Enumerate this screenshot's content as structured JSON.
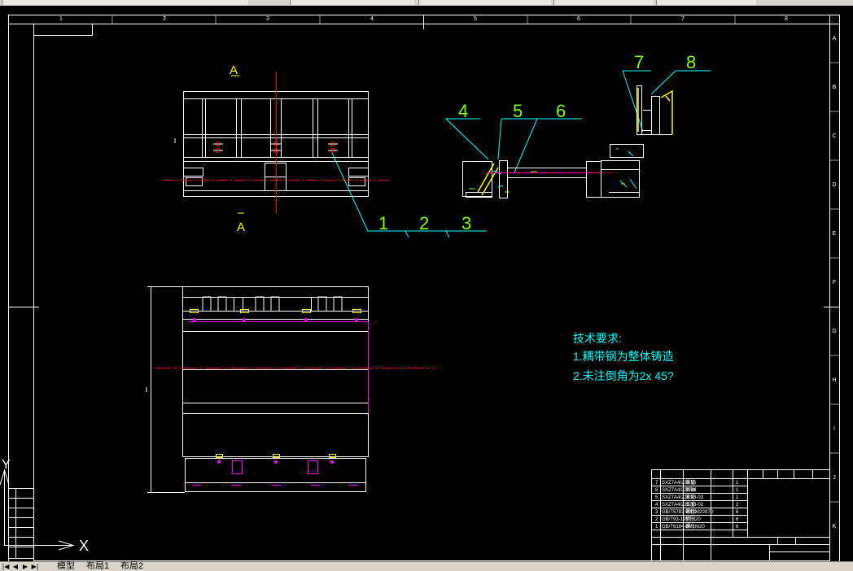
{
  "frame": {
    "column_labels": [
      "1",
      "2",
      "3",
      "4",
      "5",
      "6",
      "7",
      "8"
    ],
    "row_labels": [
      "A",
      "B",
      "C",
      "D",
      "E",
      "F",
      "G",
      "H",
      "I",
      "J",
      "K"
    ]
  },
  "section_marks": {
    "top": "A",
    "bottom": "A"
  },
  "balloons": [
    "1",
    "2",
    "3",
    "4",
    "5",
    "6",
    "7",
    "8"
  ],
  "tech_requirements": {
    "title": "技术要求:",
    "line1": "1.耦带钢为整体铸造",
    "line2": "2.未注倒角为2x 45?"
  },
  "bom_rows": [
    {
      "no": "7",
      "code": "SXZ7A4/220.15",
      "name": "螺栓",
      "qty": "1"
    },
    {
      "no": "6",
      "code": "SXZ7A4/220.14",
      "name": "销轴",
      "qty": "1"
    },
    {
      "no": "5",
      "code": "SXZ7A4/220.13-03",
      "name": "滚轮",
      "qty": "1"
    },
    {
      "no": "4",
      "code": "SXZ7A4/220.13-02",
      "name": "支座",
      "qty": "2"
    },
    {
      "no": "3",
      "code": "GB/T5783-2000",
      "name": "螺栓M20X70",
      "qty": "6"
    },
    {
      "no": "2",
      "code": "GB/T93-1987",
      "name": "垫圈20",
      "qty": "6"
    },
    {
      "no": "1",
      "code": "GB/T6184-86",
      "name": "螺母M20",
      "qty": "6"
    }
  ],
  "ucs": {
    "x": "X",
    "y": "Y"
  },
  "tabs": {
    "model": "模型",
    "layout1": "布局1",
    "layout2": "布局2"
  },
  "colors": {
    "background": "#000000",
    "white": "#ffffff",
    "cyan": "#00ffff",
    "green": "#80ff00",
    "yellow": "#ffff00",
    "red": "#ff0000",
    "magenta": "#ff00ff"
  }
}
